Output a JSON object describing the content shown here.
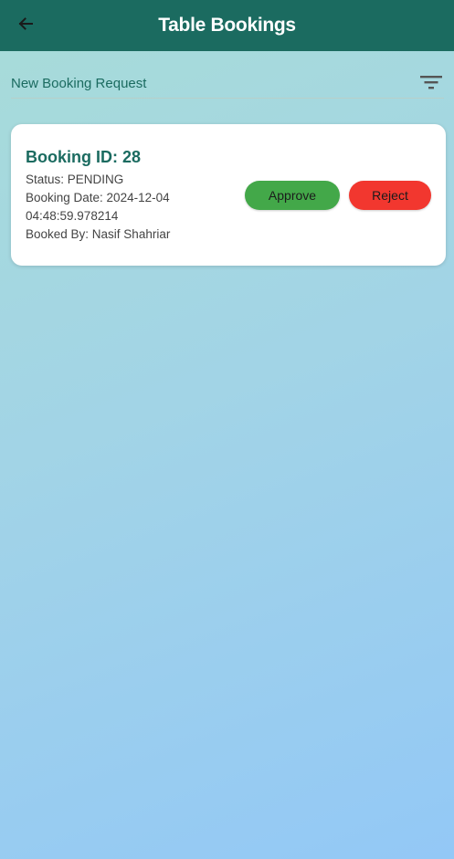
{
  "appbar": {
    "title": "Table Bookings",
    "back_icon": "arrow-left-icon",
    "color": "#1b6b60"
  },
  "filter": {
    "label": "New Booking Request",
    "icon": "filter-icon"
  },
  "booking": {
    "id_text": "Booking ID: 28",
    "status_text": "Status: PENDING",
    "date_text": "Booking Date: 2024-12-04 04:48:59.978214",
    "booked_by_text": "Booked By: Nasif Shahriar",
    "approve_label": "Approve",
    "reject_label": "Reject",
    "approve_color": "#43a849",
    "reject_color": "#f2372f"
  }
}
